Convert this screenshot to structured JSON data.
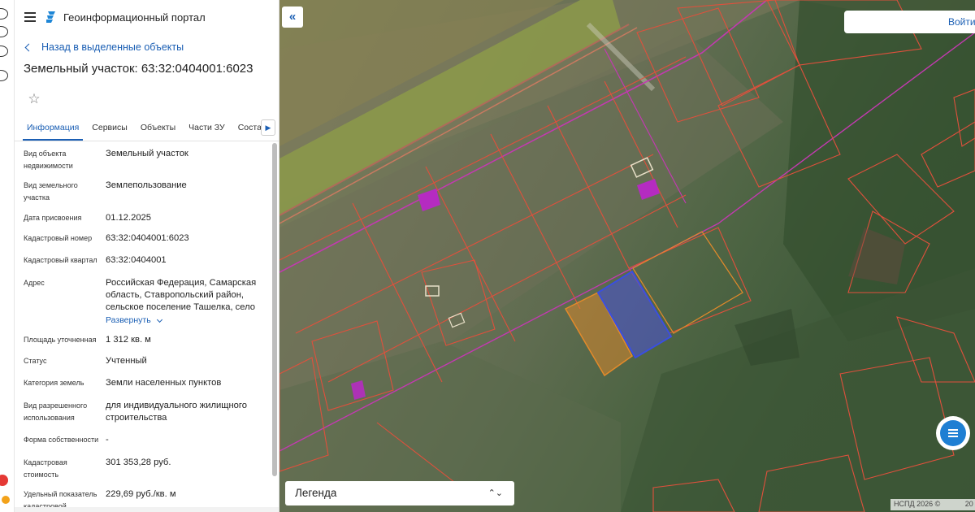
{
  "header": {
    "title": "Геоинформационный портал"
  },
  "nav": {
    "back_label": "Назад в выделенные объекты"
  },
  "object": {
    "title": "Земельный участок: 63:32:0404001:6023"
  },
  "tabs": [
    {
      "label": "Информация",
      "active": true
    },
    {
      "label": "Сервисы"
    },
    {
      "label": "Объекты"
    },
    {
      "label": "Части ЗУ"
    },
    {
      "label": "Состав"
    }
  ],
  "info": {
    "object_type": {
      "label": "Вид объекта недвижимости",
      "value": "Земельный участок"
    },
    "land_kind": {
      "label": "Вид земельного участка",
      "value": "Землепользование"
    },
    "assign_date": {
      "label": "Дата присвоения",
      "value": "01.12.2025"
    },
    "cadastral_no": {
      "label": "Кадастровый номер",
      "value": "63:32:0404001:6023"
    },
    "cadastral_q": {
      "label": "Кадастровый квартал",
      "value": "63:32:0404001"
    },
    "address": {
      "label": "Адрес",
      "value": "Российская Федерация, Самарская область, Ставропольский район, сельское поселение Ташелка, село",
      "expand": "Развернуть"
    },
    "area": {
      "label": "Площадь уточненная",
      "value": "1 312 кв. м"
    },
    "status": {
      "label": "Статус",
      "value": "Учтенный"
    },
    "category": {
      "label": "Категория земель",
      "value": "Земли населенных пунктов"
    },
    "permitted_use": {
      "label": "Вид разрешенного использования",
      "value": "для индивидуального жилищного строительства"
    },
    "ownership": {
      "label": "Форма собственности",
      "value": "-"
    },
    "cadastral_cost": {
      "label": "Кадастровая стоимость",
      "value": "301 353,28 руб."
    },
    "specific_cost": {
      "label": "Удельный показатель кадастровой",
      "value": "229,69 руб./кв. м"
    }
  },
  "map": {
    "login_label": "Войти",
    "legend_label": "Легенда",
    "attribution": "НСПД 2026 ©",
    "attribution_suffix": "20"
  },
  "colors": {
    "accent": "#1b5fb4",
    "parcel_border": "#e0503c",
    "quarter_border": "#c23ab0",
    "selected": "#3a4fe0",
    "orange": "#e38a2a"
  }
}
